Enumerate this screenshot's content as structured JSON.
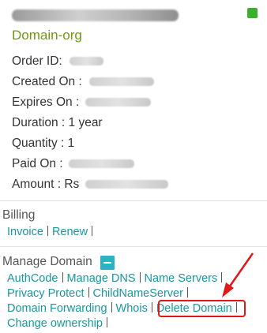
{
  "order": {
    "product": "Domain-org",
    "order_id_label": "Order ID: ",
    "created_label": "Created On : ",
    "expires_label": "Expires On : ",
    "duration_label": "Duration : ",
    "duration_value": "1 year",
    "quantity_label": "Quantity : ",
    "quantity_value": "1",
    "paid_label": "Paid On : ",
    "amount_label": "Amount : ",
    "amount_currency": "Rs "
  },
  "billing": {
    "title": "Billing",
    "links": [
      "Invoice",
      "Renew"
    ]
  },
  "manage_domain": {
    "title": "Manage Domain",
    "links": [
      "AuthCode",
      "Manage DNS",
      "Name Servers",
      "Privacy Protect",
      "ChildNameServer",
      "Domain Forwarding",
      "Whois",
      "Delete Domain",
      "Change ownership"
    ]
  },
  "colors": {
    "status": "#3bb02f",
    "product": "#6f9a0e",
    "link": "#19979f",
    "annotation": "#e01818"
  }
}
